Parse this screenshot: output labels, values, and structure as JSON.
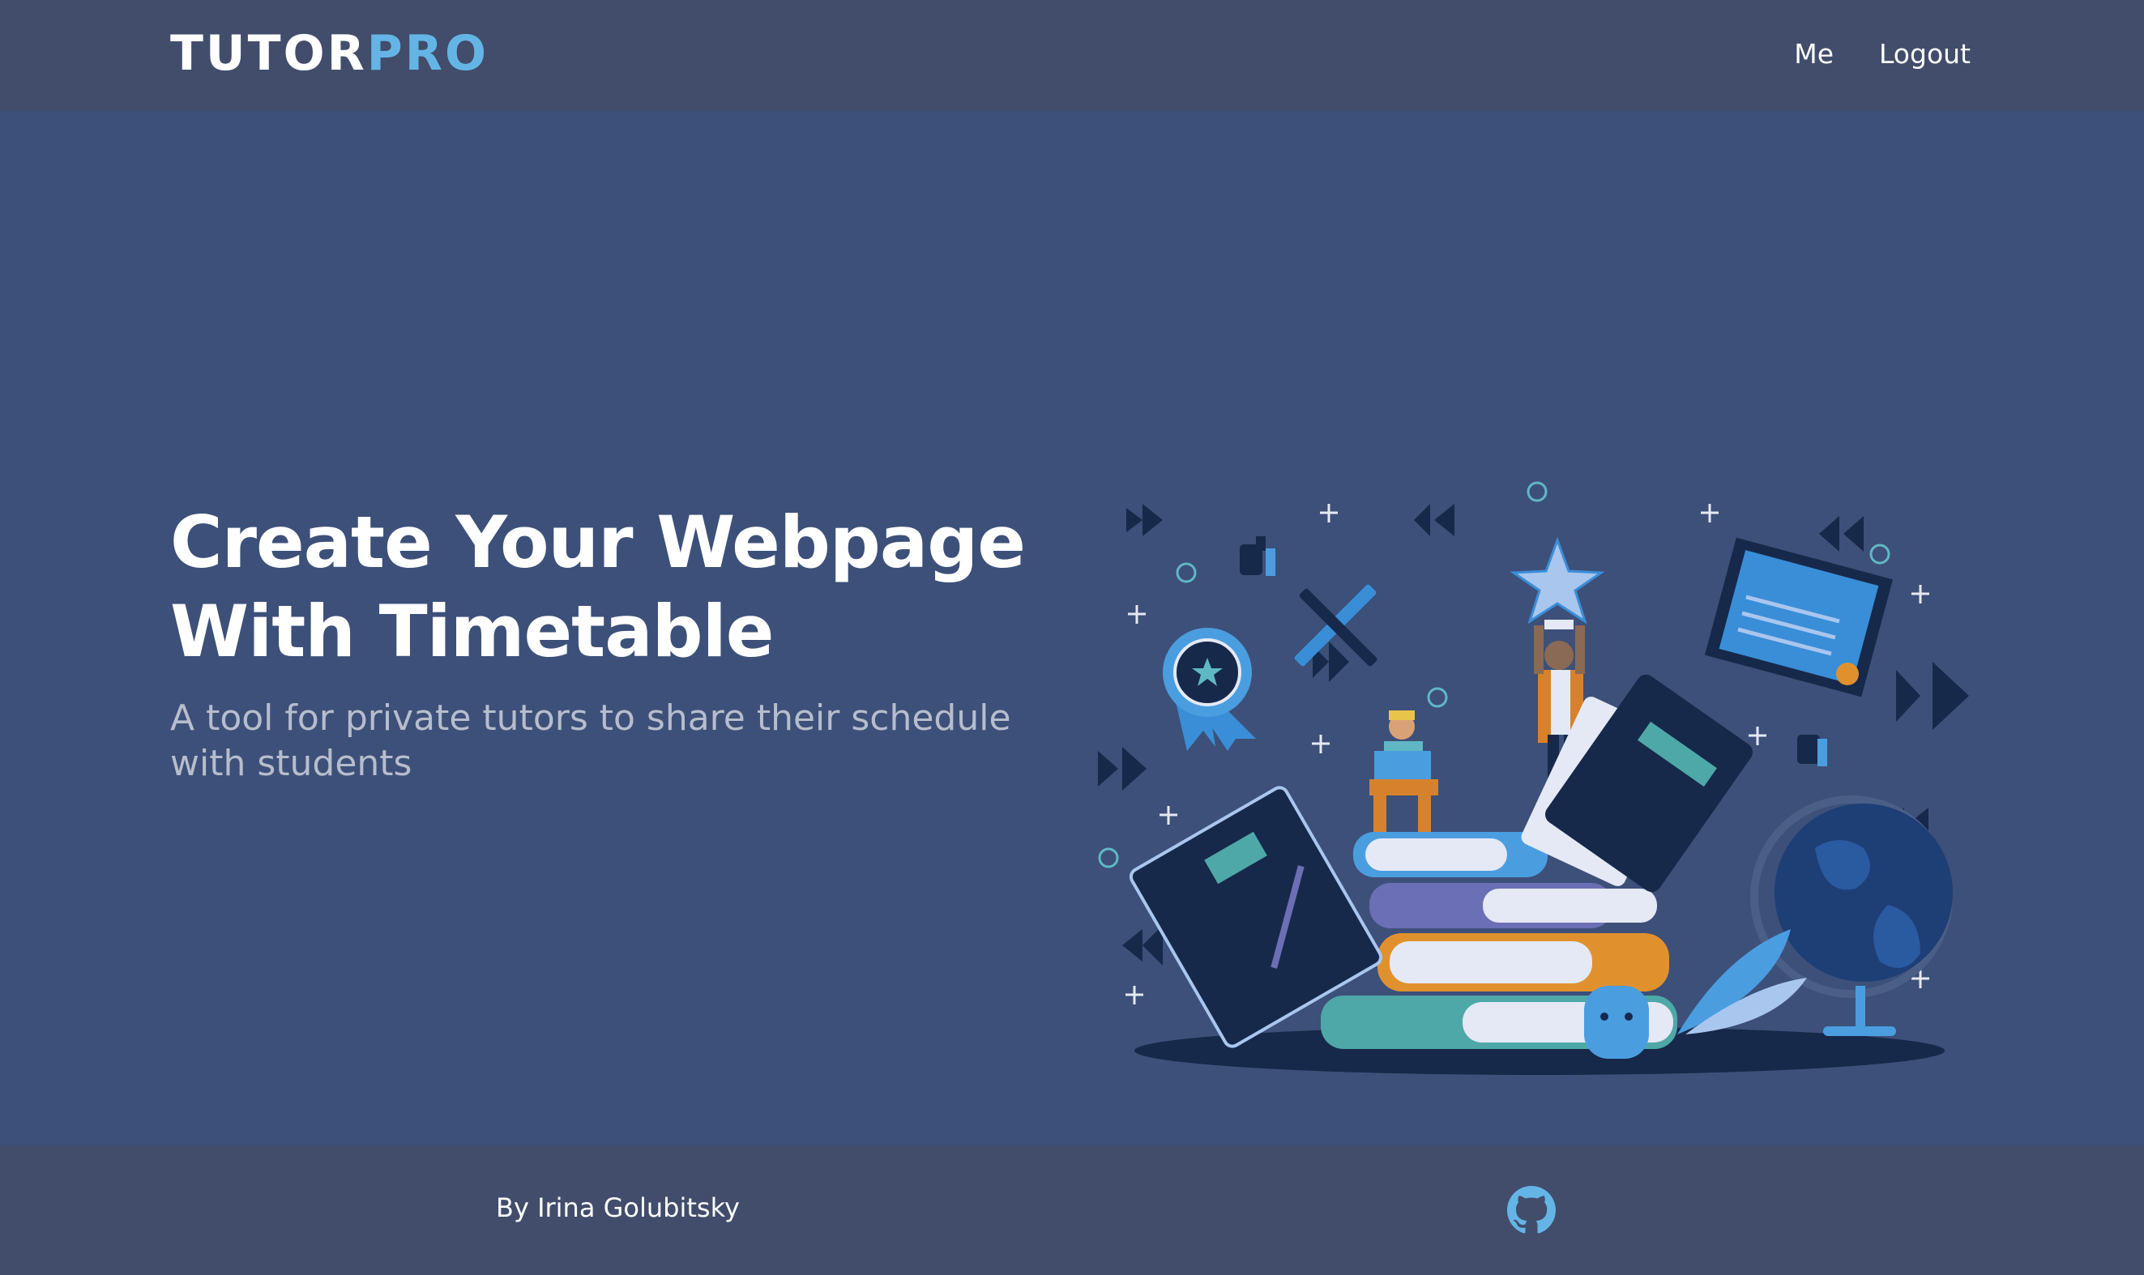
{
  "navbar": {
    "logo_primary": "TUTOR",
    "logo_accent": "PRO",
    "links": [
      {
        "label": "Me"
      },
      {
        "label": "Logout"
      }
    ]
  },
  "hero": {
    "title_line1": "Create Your Webpage",
    "title_line2": "With Timetable",
    "subtitle": "A tool for private tutors to share their schedule with students",
    "illustration_icon": "education-illustration"
  },
  "footer": {
    "credit": "By Irina Golubitsky",
    "github_icon": "github-icon"
  },
  "colors": {
    "navbar_bg": "#414d6b",
    "hero_bg": "#3d5079",
    "logo_accent": "#64b5e6",
    "subtitle": "#b6bdcc",
    "github_icon": "#64b5e6"
  }
}
